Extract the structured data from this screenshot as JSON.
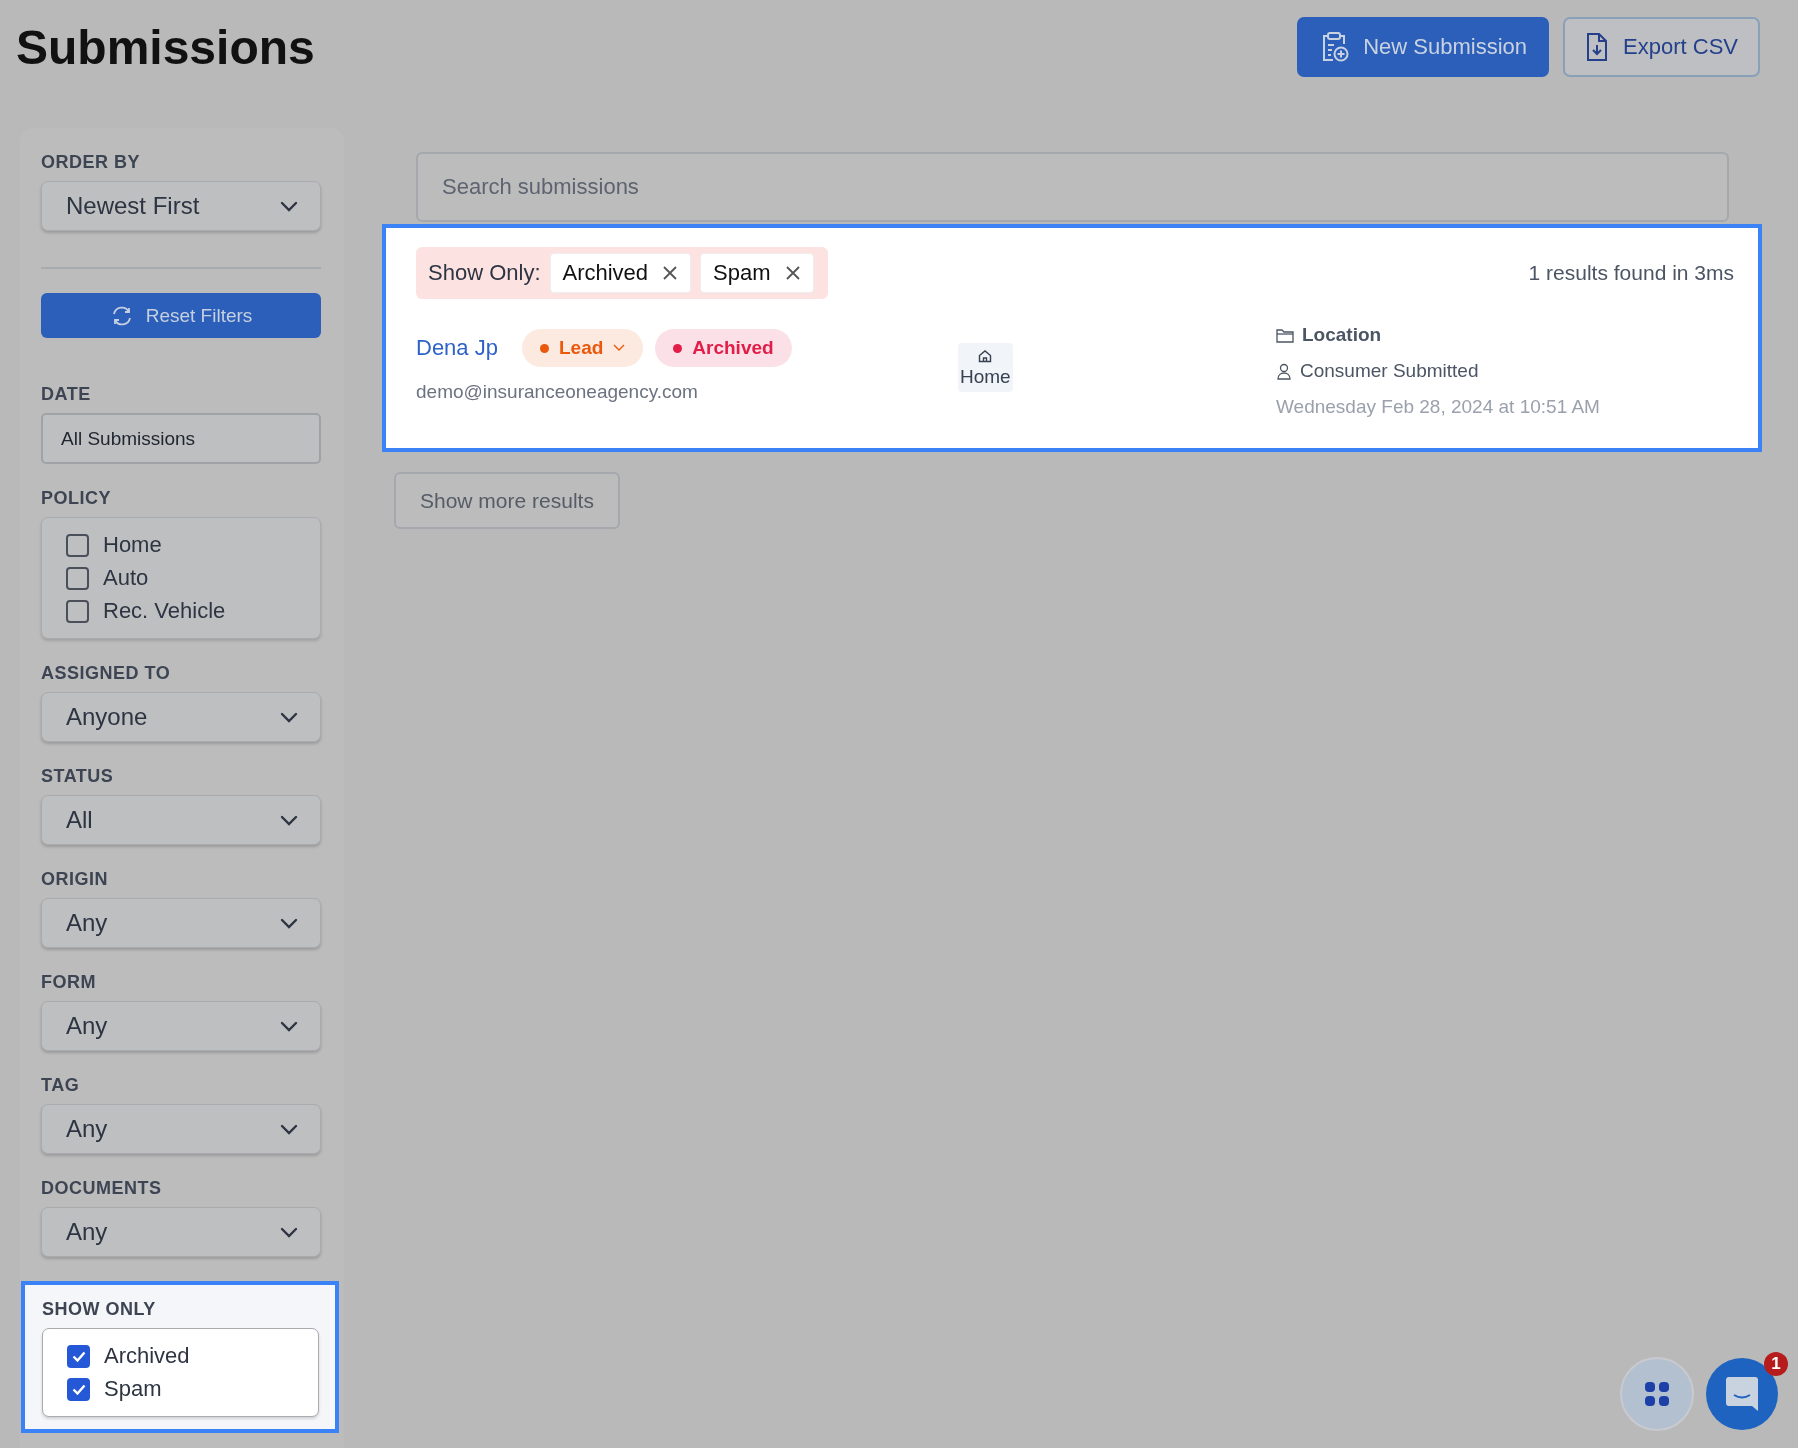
{
  "header": {
    "title": "Submissions",
    "actions": [
      {
        "label": "New Submission",
        "kind": "primary"
      },
      {
        "label": "Export CSV",
        "kind": "outline"
      }
    ]
  },
  "sidebar": {
    "order_by": {
      "label": "ORDER BY",
      "value": "Newest First"
    },
    "reset_button": "Reset Filters",
    "filters": [
      {
        "kind": "field",
        "label": "DATE",
        "value": "All Submissions"
      },
      {
        "kind": "checkboxes",
        "label": "POLICY",
        "options": [
          {
            "label": "Home",
            "checked": false
          },
          {
            "label": "Auto",
            "checked": false
          },
          {
            "label": "Rec. Vehicle",
            "checked": false
          }
        ]
      },
      {
        "kind": "select",
        "label": "ASSIGNED TO",
        "value": "Anyone"
      },
      {
        "kind": "select",
        "label": "STATUS",
        "value": "All"
      },
      {
        "kind": "select",
        "label": "ORIGIN",
        "value": "Any"
      },
      {
        "kind": "select",
        "label": "FORM",
        "value": "Any"
      },
      {
        "kind": "select",
        "label": "TAG",
        "value": "Any"
      },
      {
        "kind": "select",
        "label": "DOCUMENTS",
        "value": "Any"
      }
    ],
    "show_only": {
      "label": "SHOW ONLY",
      "options": [
        {
          "label": "Archived",
          "checked": true
        },
        {
          "label": "Spam",
          "checked": true
        }
      ]
    }
  },
  "main": {
    "search": {
      "placeholder": "Search submissions"
    },
    "active_filters": {
      "label": "Show Only:",
      "chips": [
        "Archived",
        "Spam"
      ]
    },
    "results_summary": "1 results found in 3ms",
    "results": [
      {
        "name": "Dena Jp",
        "email": "demo@insuranceoneagency.com",
        "badges": [
          {
            "label": "Lead",
            "color": "#ea580c",
            "kind": "dropdown"
          },
          {
            "label": "Archived",
            "color": "#e11d48",
            "kind": "plain"
          }
        ],
        "policy": "Home",
        "location": "Location",
        "origin": "Consumer Submitted",
        "date": "Wednesday Feb 28, 2024 at 10:51 AM"
      }
    ],
    "show_more": "Show more results"
  },
  "chat": {
    "unread": "1"
  }
}
